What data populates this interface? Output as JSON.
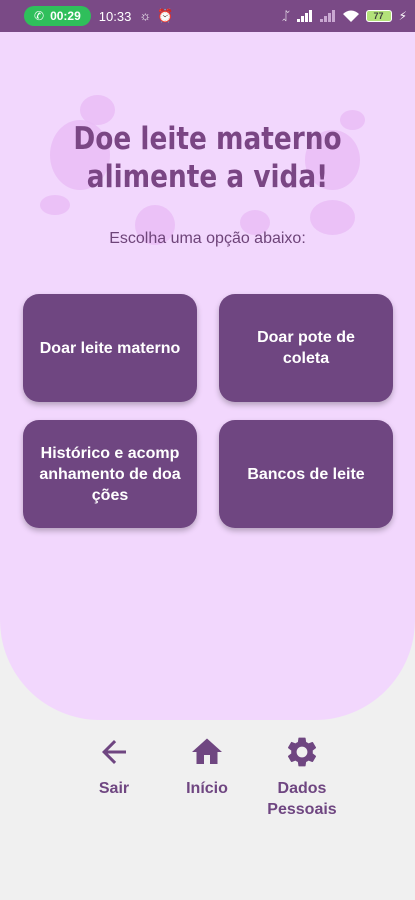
{
  "statusbar": {
    "call_time": "00:29",
    "clock": "10:33",
    "battery_level": "77",
    "icons": [
      "phone-icon",
      "brightness-icon",
      "alarm-icon",
      "bluetooth-icon",
      "signal-icon",
      "wifi-icon",
      "battery-icon",
      "charging-icon"
    ]
  },
  "hero": {
    "line1": "Doe leite materno",
    "line2": "alimente a vida!"
  },
  "subtitle": "Escolha uma opção abaixo:",
  "options": [
    {
      "label": "Doar leite materno"
    },
    {
      "label": "Doar pote de coleta"
    },
    {
      "label": "Histórico e acompanhamento de doações"
    },
    {
      "label": "Bancos de leite"
    }
  ],
  "nav": {
    "items": [
      {
        "label": "Sair",
        "icon": "arrow-back-icon"
      },
      {
        "label": "Início",
        "icon": "home-icon"
      },
      {
        "label": "Dados Pessoais",
        "icon": "gear-icon"
      }
    ]
  },
  "colors": {
    "primary": "#6f4681",
    "panel": "#f2d7fd",
    "background": "#f0f0f0"
  }
}
